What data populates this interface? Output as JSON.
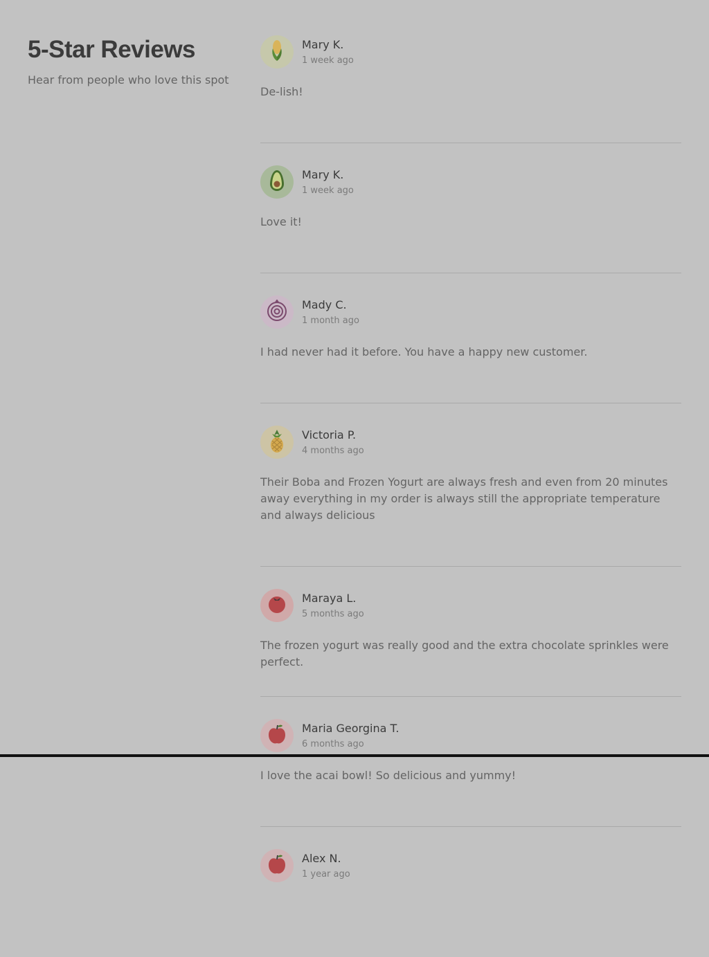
{
  "header": {
    "title": "5-Star Reviews",
    "subtitle": "Hear from people who love this spot"
  },
  "reviews": [
    {
      "name": "Mary K.",
      "date": "1 week ago",
      "text": "De-lish!",
      "avatar_icon": "corn-icon",
      "avatar_bg": "#c6c8ab"
    },
    {
      "name": "Mary K.",
      "date": "1 week ago",
      "text": "Love it!",
      "avatar_icon": "avocado-icon",
      "avatar_bg": "#a8b99a"
    },
    {
      "name": "Mady C.",
      "date": "1 month ago",
      "text": "I had never had it before. You have a happy new customer.",
      "avatar_icon": "onion-icon",
      "avatar_bg": "#cbb9c7"
    },
    {
      "name": "Victoria P.",
      "date": "4 months ago",
      "text": "Their Boba and Frozen Yogurt are always fresh and even from 20 minutes away everything in my order is always still the appropriate temperature and always delicious",
      "avatar_icon": "pineapple-icon",
      "avatar_bg": "#cdc4a5"
    },
    {
      "name": "Maraya L.",
      "date": "5 months ago",
      "text": "The frozen yogurt was really good and the extra chocolate sprinkles were perfect.",
      "avatar_icon": "tomato-icon",
      "avatar_bg": "#d0a9a9"
    },
    {
      "name": "Maria Georgina T.",
      "date": "6 months ago",
      "text": "I love the acai bowl! So delicious and yummy!",
      "avatar_icon": "apple-icon",
      "avatar_bg": "#d0b3b5"
    },
    {
      "name": "Alex N.",
      "date": "1 year ago",
      "text": "",
      "avatar_icon": "apple-icon",
      "avatar_bg": "#d0b3b5"
    }
  ]
}
